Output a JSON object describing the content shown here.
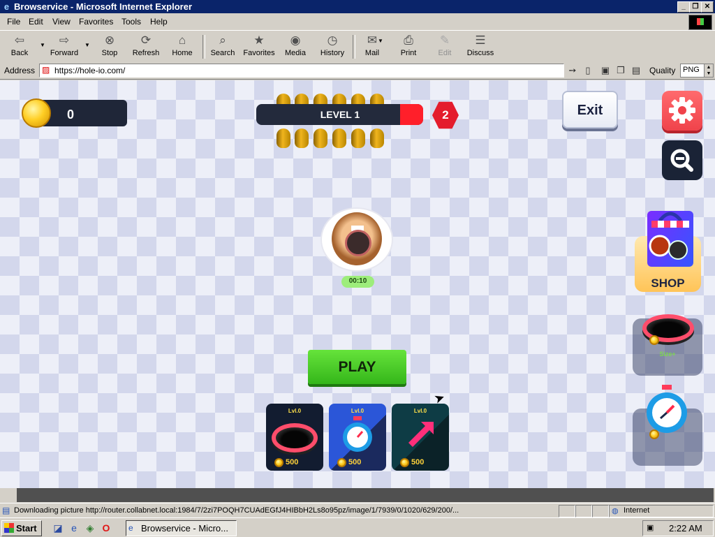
{
  "window": {
    "title": "Browservice - Microsoft Internet Explorer",
    "btn_min": "_",
    "btn_max": "❐",
    "btn_close": "✕"
  },
  "menu": [
    "File",
    "Edit",
    "View",
    "Favorites",
    "Tools",
    "Help"
  ],
  "toolbar": {
    "back": "Back",
    "forward": "Forward",
    "stop": "Stop",
    "refresh": "Refresh",
    "home": "Home",
    "search": "Search",
    "favorites": "Favorites",
    "media": "Media",
    "history": "History",
    "mail": "Mail",
    "print": "Print",
    "edit": "Edit",
    "discuss": "Discuss"
  },
  "address": {
    "label": "Address",
    "url": "https://hole-io.com/",
    "quality_label": "Quality",
    "quality_value": "PNG"
  },
  "game": {
    "coins": "0",
    "level_label": "LEVEL 1",
    "level_badge": "2",
    "exit_label": "Exit",
    "shop_label": "SHOP",
    "size_label": "Size+",
    "timer": "00:10",
    "play_label": "PLAY",
    "upgrades": [
      {
        "level": "Lvl.0",
        "price": "500"
      },
      {
        "level": "Lvl.0",
        "price": "500"
      },
      {
        "level": "Lvl.0",
        "price": "500"
      }
    ]
  },
  "status": {
    "text": "Downloading picture http://router.collabnet.local:1984/7/2zi7POQH7CUAdEGfJ4HIBbH2Ls8o95pz/image/1/7939/0/1020/629/200/...",
    "zone": "Internet"
  },
  "taskbar": {
    "start": "Start",
    "task": "Browservice - Micro...",
    "clock": "2:22 AM"
  },
  "colors": {
    "title_bar": "#0a246a",
    "chrome": "#d4d0c8",
    "play_green": "#45c526",
    "level_red": "#ff1f2a",
    "gear_red": "#f0434b"
  }
}
